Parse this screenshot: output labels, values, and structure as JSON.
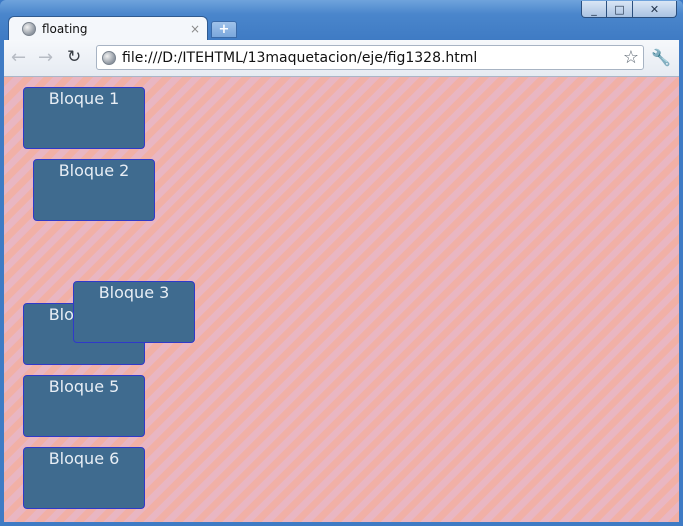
{
  "window": {
    "controls": [
      "_",
      "□",
      "✕"
    ]
  },
  "tab": {
    "title": "floating",
    "close": "×",
    "new_tab": "+"
  },
  "toolbar": {
    "back": "←",
    "forward": "→",
    "reload": "↻",
    "url": "file:///D:/ITEHTML/13maquetacion/eje/fig1328.html",
    "star": "☆",
    "wrench": "🔧"
  },
  "blocks": [
    {
      "label": "Bloque 1"
    },
    {
      "label": "Bloque 2"
    },
    {
      "label": "Bloque 4"
    },
    {
      "label": "Bloque 3"
    },
    {
      "label": "Bloque 5"
    },
    {
      "label": "Bloque 6"
    }
  ],
  "colors": {
    "block_fill": "#3f6b8f",
    "block_border": "#2f39c9",
    "stripe_a": "#f1b0a6",
    "stripe_b": "#e9b6c2"
  }
}
